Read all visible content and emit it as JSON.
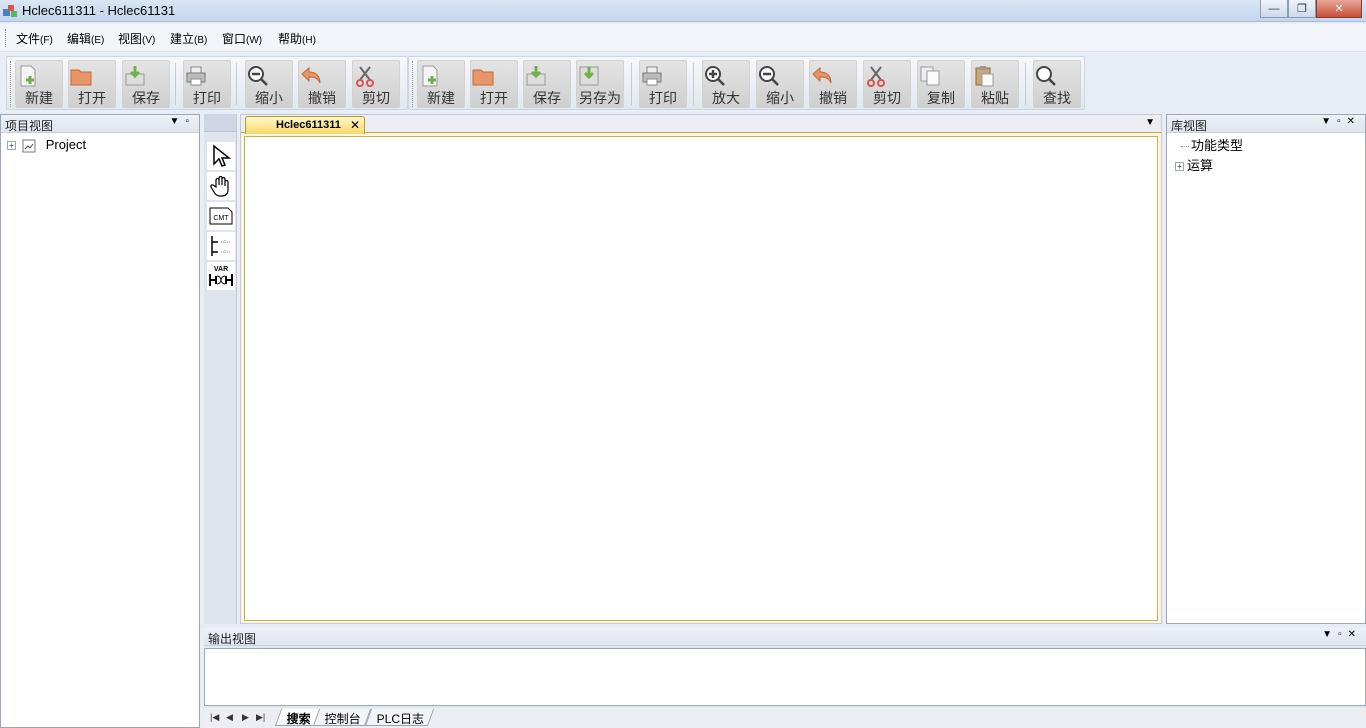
{
  "window": {
    "title": "Hclec611311 - Hclec61131"
  },
  "menu": [
    {
      "label": "文件",
      "mnemonic": "(F)"
    },
    {
      "label": "编辑",
      "mnemonic": "(E)"
    },
    {
      "label": "视图",
      "mnemonic": "(V)"
    },
    {
      "label": "建立",
      "mnemonic": "(B)"
    },
    {
      "label": "窗口",
      "mnemonic": "(W)"
    },
    {
      "label": "帮助",
      "mnemonic": "(H)"
    }
  ],
  "toolbar1": {
    "buttons": [
      {
        "label": "新建",
        "icon": "new-file-icon"
      },
      {
        "label": "打开",
        "icon": "open-folder-icon"
      },
      {
        "label": "保存",
        "icon": "save-icon"
      },
      {
        "label": "打印",
        "icon": "print-icon"
      },
      {
        "label": "缩小",
        "icon": "zoom-out-icon"
      },
      {
        "label": "撤销",
        "icon": "undo-icon"
      },
      {
        "label": "剪切",
        "icon": "cut-icon"
      }
    ]
  },
  "toolbar2": {
    "buttons": [
      {
        "label": "新建",
        "icon": "new-file-icon"
      },
      {
        "label": "打开",
        "icon": "open-folder-icon"
      },
      {
        "label": "保存",
        "icon": "save-icon"
      },
      {
        "label": "另存为",
        "icon": "save-as-icon"
      },
      {
        "label": "打印",
        "icon": "print-icon"
      },
      {
        "label": "放大",
        "icon": "zoom-in-icon"
      },
      {
        "label": "缩小",
        "icon": "zoom-out-icon"
      },
      {
        "label": "撤销",
        "icon": "undo-icon"
      },
      {
        "label": "剪切",
        "icon": "cut-icon"
      },
      {
        "label": "复制",
        "icon": "copy-icon"
      },
      {
        "label": "粘贴",
        "icon": "paste-icon"
      },
      {
        "label": "查找",
        "icon": "find-icon"
      }
    ]
  },
  "project_view": {
    "title": "项目视图",
    "root": "Project"
  },
  "library_view": {
    "title": "库视图",
    "items": [
      "功能类型",
      "运算"
    ]
  },
  "palette": {
    "tools": [
      {
        "icon": "pointer-icon"
      },
      {
        "icon": "hand-pan-icon"
      },
      {
        "icon": "comment-icon",
        "text": "CMT"
      },
      {
        "icon": "contact-icon"
      },
      {
        "icon": "variable-icon",
        "text": "VAR"
      }
    ]
  },
  "editor": {
    "tab_label": "Hclec611311"
  },
  "output_view": {
    "title": "输出视图",
    "tabs": [
      "搜索",
      "控制台",
      "PLC日志"
    ],
    "active_tab": "搜索"
  }
}
